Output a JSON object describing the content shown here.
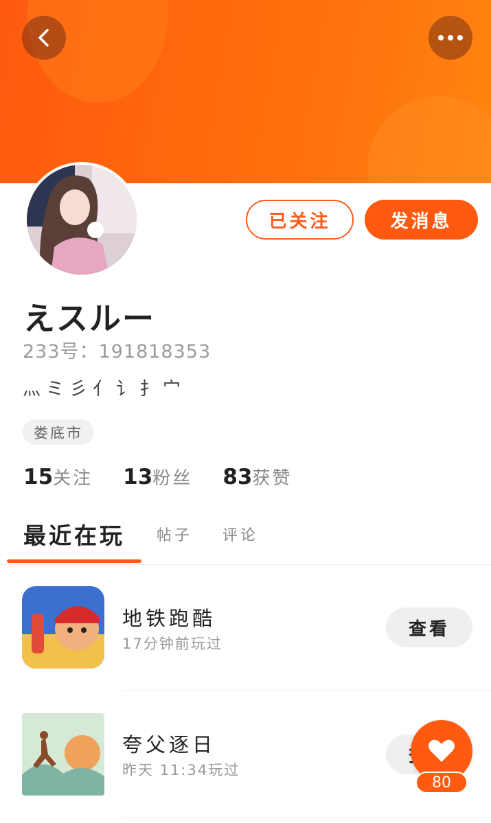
{
  "header": {
    "back_icon": "chevron-left-icon",
    "more_icon": "more-dots-icon",
    "banner_color": "#ff6a0d"
  },
  "profile": {
    "follow_label": "已关注",
    "message_label": "发消息",
    "username": "えスルー",
    "uid": "233号：191818353",
    "bio": "灬ミ彡亻讠扌宀",
    "city": "娄底市",
    "stats": [
      {
        "value": "15",
        "label": "关注"
      },
      {
        "value": "13",
        "label": "粉丝"
      },
      {
        "value": "83",
        "label": "获赞"
      }
    ]
  },
  "tabs": {
    "active": "最近在玩",
    "posts": "帖子",
    "comments": "评论"
  },
  "games": [
    {
      "name": "地铁跑酷",
      "played": "17分钟前玩过",
      "action": "查看"
    },
    {
      "name": "夸父逐日",
      "played": "昨天 11:34玩过",
      "action": "查看"
    }
  ],
  "like": {
    "icon": "heart-icon",
    "count": "80"
  },
  "colors": {
    "accent": "#ff5a0f",
    "muted_text": "#9a9a9a"
  }
}
